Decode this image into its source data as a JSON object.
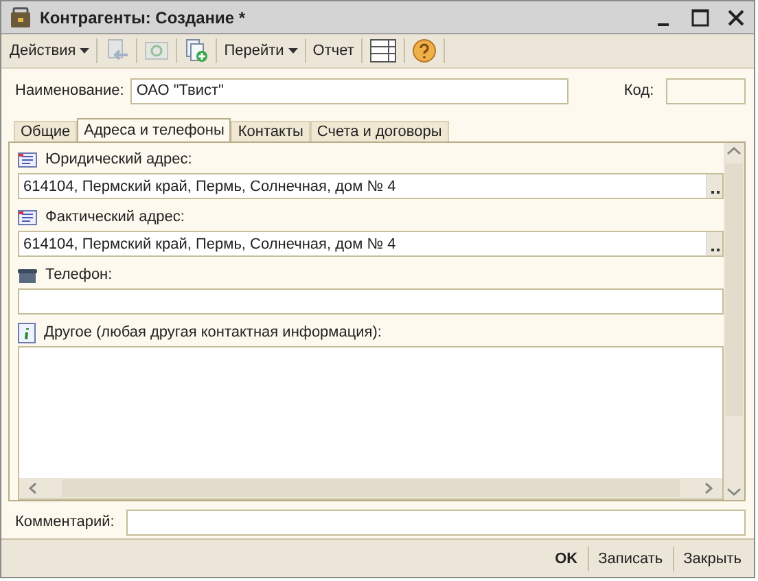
{
  "window": {
    "title": "Контрагенты: Создание *"
  },
  "toolbar": [
    {
      "kind": "menu",
      "label": "Действия"
    },
    {
      "kind": "icon",
      "disabled": true
    },
    {
      "kind": "icon",
      "disabled": true
    },
    {
      "kind": "icon",
      "disabled": false
    },
    {
      "kind": "menu",
      "label": "Перейти"
    },
    {
      "kind": "button",
      "label": "Отчет"
    },
    {
      "kind": "icon",
      "disabled": false
    },
    {
      "kind": "icon",
      "disabled": false
    }
  ],
  "name_field": {
    "label": "Наименование:",
    "value": "ОАО \"Твист\""
  },
  "code_field": {
    "label": "Код:"
  },
  "tabs": [
    {
      "label": "Общие",
      "selected": false
    },
    {
      "label": "Адреса и телефоны",
      "selected": true
    },
    {
      "label": "Контакты",
      "selected": false
    },
    {
      "label": "Счета и договоры",
      "selected": false
    }
  ],
  "contacts": [
    {
      "kind": "address",
      "label": "Юридический адрес:",
      "value": "614104, Пермский край, Пермь, Солнечная, дом № 4"
    },
    {
      "kind": "address",
      "label": "Фактический адрес:",
      "value": "614104, Пермский край, Пермь, Солнечная, дом № 4"
    },
    {
      "kind": "phone",
      "label": "Телефон:"
    },
    {
      "kind": "other",
      "label": "Другое (любая другая контактная информация):"
    }
  ],
  "comment_field": {
    "label": "Комментарий:"
  },
  "buttons": [
    {
      "label": "OK",
      "default": true
    },
    {
      "label": "Записать",
      "default": false
    },
    {
      "label": "Закрыть",
      "default": false
    }
  ]
}
